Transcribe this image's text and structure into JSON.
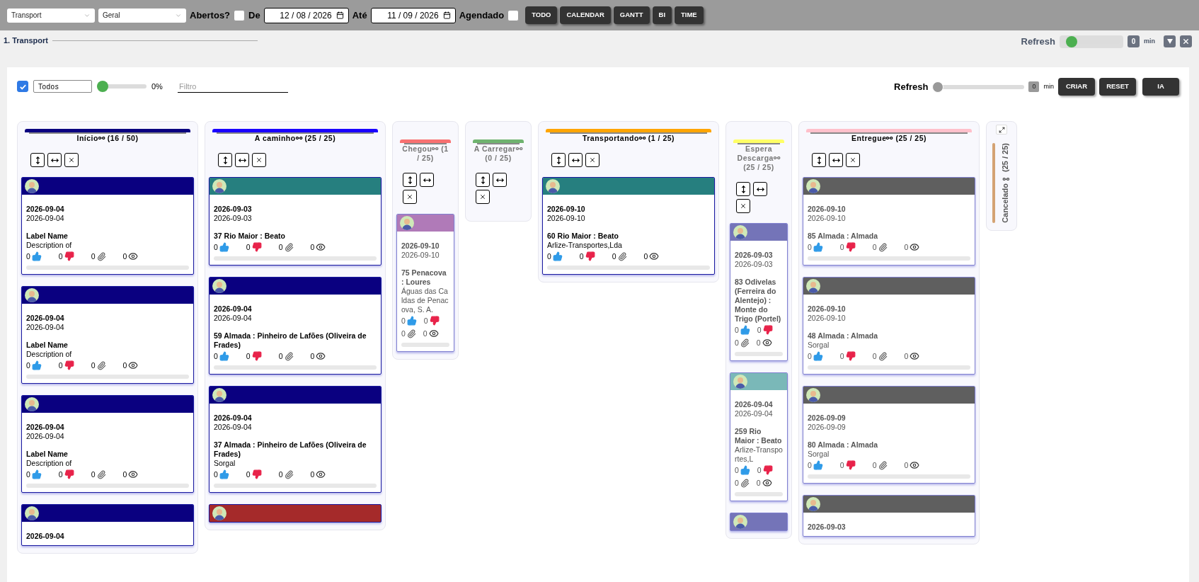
{
  "toolbar": {
    "selects": [
      "Transport",
      "Geral"
    ],
    "open_filter": {
      "label": "Abertos?",
      "checked": false
    },
    "from": {
      "label": "De",
      "value": "12 / 08 / 2026"
    },
    "to": {
      "label": "Até",
      "value": "11 / 09 / 2026"
    },
    "scheduled": {
      "label": "Agendado",
      "checked": false
    },
    "buttons": [
      "TODO",
      "CALENDAR",
      "GANTT",
      "BI",
      "TIME"
    ]
  },
  "section": {
    "title": "1. Transport",
    "refresh": {
      "label": "Refresh",
      "level": 0.08,
      "value": "0",
      "unit": "min"
    }
  },
  "board_toolbar": {
    "select_all": {
      "checked": true
    },
    "select": "Todos",
    "slider": {
      "level": 0,
      "reading": "0%"
    },
    "filter": {
      "placeholder": "Filtro"
    },
    "refresh": {
      "label": "Refresh",
      "level": 0,
      "value": "0",
      "unit": "min"
    },
    "buttons": [
      "CRIAR",
      "RESET",
      "IA"
    ]
  },
  "columns": [
    {
      "kind": "wide",
      "title": "Início⚯ (16 / 50)",
      "color": "#0a0080",
      "cards": [
        {
          "color": "#0a0080",
          "dimmed": false,
          "dates": [
            "2026-09-04",
            "2026-09-04"
          ],
          "title": "Label Name",
          "description": "Description of",
          "counts": [
            "0",
            "0",
            "0",
            "0"
          ],
          "level": 0
        },
        {
          "color": "#0a0080",
          "dimmed": false,
          "dates": [
            "2026-09-04",
            "2026-09-04"
          ],
          "title": "Label Name",
          "description": "Description of",
          "counts": [
            "0",
            "0",
            "0",
            "0"
          ],
          "level": 0
        },
        {
          "color": "#0a0080",
          "dimmed": false,
          "dates": [
            "2026-09-04",
            "2026-09-04"
          ],
          "title": "Label Name",
          "description": "Description of",
          "counts": [
            "0",
            "0",
            "0",
            "0"
          ],
          "level": 0
        },
        {
          "color": "#0a0080",
          "dimmed": false,
          "dates": [
            "2026-09-04"
          ]
        }
      ]
    },
    {
      "kind": "wide",
      "title": "A caminho⚯ (25 / 25)",
      "color": "#1a00ff",
      "cards": [
        {
          "color": "#267f7f",
          "dimmed": false,
          "dates": [
            "2026-09-03",
            "2026-09-03"
          ],
          "title": "37 Rio Maior : Beato",
          "counts": [
            "0",
            "0",
            "0",
            "0"
          ],
          "level": 0
        },
        {
          "color": "#0a0080",
          "dimmed": false,
          "dates": [
            "2026-09-04",
            "2026-09-04"
          ],
          "title": "59 Almada : Pinheiro de Lafões (Oliveira de Frades)",
          "counts": [
            "0",
            "0",
            "0",
            "0"
          ],
          "level": 0
        },
        {
          "color": "#0a0080",
          "dimmed": false,
          "dates": [
            "2026-09-04",
            "2026-09-04"
          ],
          "title": "37 Almada : Pinheiro de Lafões (Oliveira de Frades)",
          "description": "Sorgal",
          "counts": [
            "0",
            "0",
            "0",
            "0"
          ],
          "level": 0
        },
        {
          "color": "#a52a2a",
          "dimmed": false
        }
      ]
    },
    {
      "kind": "narrow",
      "title": "Chegou⚯ (1 / 25)",
      "color": "#f87171",
      "cards": [
        {
          "color": "#b07ab8",
          "dimmed": true,
          "dates": [
            "2026-09-10",
            "2026-09-10"
          ],
          "title": "75 Penacova : Loures",
          "description": "Águas das Caldas de Penacova, S. A.",
          "counts": [
            "0",
            "0",
            "0",
            "0"
          ],
          "level": 0
        }
      ]
    },
    {
      "kind": "narrow",
      "title": "A Carregar⚯ (0 / 25)",
      "color": "#6fb36f"
    },
    {
      "kind": "wide",
      "title": "Transportando⚯ (1 / 25)",
      "color": "#ffa500",
      "cards": [
        {
          "color": "#267f7f",
          "dimmed": false,
          "dates": [
            "2026-09-10",
            "2026-09-10"
          ],
          "title": "60 Rio Maior : Beato",
          "description": "Arlize-Transportes,Lda",
          "counts": [
            "0",
            "0",
            "0",
            "0"
          ],
          "level": 0
        }
      ]
    },
    {
      "kind": "narrow",
      "title": "Espera Descarga⚯ (25 / 25)",
      "color": "#ffff66",
      "cards": [
        {
          "color": "#7474b8",
          "dimmed": true,
          "dates": [
            "2026-09-03",
            "2026-09-03"
          ],
          "title": "83 Odivelas (Ferreira do Alentejo) : Monte do Trigo (Portel)",
          "counts": [
            "0",
            "0",
            "0",
            "0"
          ],
          "level": 0
        },
        {
          "color": "#7ab8b8",
          "dimmed": true,
          "dates": [
            "2026-09-04",
            "2026-09-04"
          ],
          "title": "259 Rio Maior : Beato",
          "description": "Arlize-Transportes,L",
          "counts": [
            "0",
            "0",
            "0",
            "0"
          ],
          "level": 0
        },
        {
          "color": "#7474b8",
          "dimmed": true
        }
      ]
    },
    {
      "kind": "wide",
      "title": "Entregue⚯ (25 / 25)",
      "color": "#ffc0cb",
      "cards": [
        {
          "color": "#5f5f5f",
          "dimmed": true,
          "dates": [
            "2026-09-10",
            "2026-09-10"
          ],
          "title": "85 Almada : Almada",
          "counts": [
            "0",
            "0",
            "0",
            "0"
          ],
          "level": 0
        },
        {
          "color": "#5f5f5f",
          "dimmed": true,
          "dates": [
            "2026-09-10",
            "2026-09-10"
          ],
          "title": "48 Almada : Almada",
          "description": "Sorgal",
          "counts": [
            "0",
            "0",
            "0",
            "0"
          ],
          "level": 0
        },
        {
          "color": "#5f5f5f",
          "dimmed": true,
          "dates": [
            "2026-09-09",
            "2026-09-09"
          ],
          "title": "80 Almada : Almada",
          "description": "Sorgal",
          "counts": [
            "0",
            "0",
            "0",
            "0"
          ],
          "level": 0
        },
        {
          "color": "#5f5f5f",
          "dimmed": true,
          "dates": [
            "2026-09-03"
          ]
        }
      ]
    },
    {
      "kind": "collapsed",
      "title": "Cancelado⚯ (25 / 25)",
      "color": "#d4a373"
    }
  ]
}
